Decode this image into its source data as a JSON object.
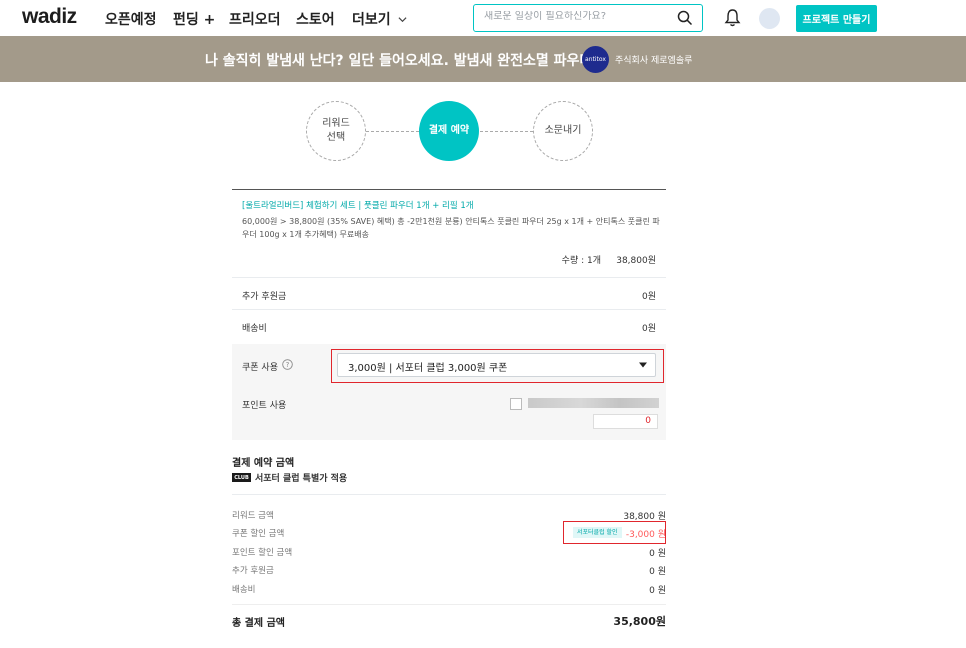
{
  "header": {
    "logo": "wadiz",
    "nav": [
      "오픈예정",
      "펀딩 +",
      "프리오더",
      "스토어",
      "더보기"
    ],
    "search_placeholder": "새로운 일상이 필요하신가요?",
    "make_button": "프로젝트 만들기"
  },
  "banner": {
    "title": "나 솔직히 발냄새 난다? 일단 들어오세요. 발냄새 완전소멸 파우더",
    "maker_logo_text": "antitox",
    "maker_name": "주식회사 제로엠솔루"
  },
  "steps": [
    {
      "label_line1": "리워드",
      "label_line2": "선택"
    },
    {
      "label_line1": "결제 예약",
      "label_line2": ""
    },
    {
      "label_line1": "소문내기",
      "label_line2": ""
    }
  ],
  "order": {
    "reward_title": "[울트라얼리버드] 체험하기 세트 | 풋클린 파우더 1개 + 리필 1개",
    "reward_desc": "60,000원 > 38,800원 (35% SAVE) 혜택) 총 -2만1천원 분룡) 안티톡스 풋클린 파우더 25g x 1개 + 안티톡스 풋클린 파우더 100g x 1개 추가혜택) 무료배송",
    "qty_label": "수량 : 1개",
    "qty_price": "38,800원",
    "extra_support_label": "추가 후원금",
    "extra_support_value": "0원",
    "shipping_label": "배송비",
    "shipping_value": "0원",
    "coupon_label": "쿠폰 사용",
    "coupon_selected": "3,000원 | 서포터 클럽 3,000원 쿠폰",
    "point_label": "포인트 사용",
    "point_value": "0"
  },
  "summary": {
    "title": "결제 예약 금액",
    "club_badge": "CLUB",
    "club_text": "서포터 클럽 특별가 적용",
    "rows": [
      {
        "label": "리워드 금액",
        "value": "38,800 원"
      },
      {
        "label": "쿠폰 할인 금액",
        "value": "-3,000 원",
        "chip": "서포터클럽 할인"
      },
      {
        "label": "포인트 할인 금액",
        "value": "0 원"
      },
      {
        "label": "추가 후원금",
        "value": "0 원"
      },
      {
        "label": "배송비",
        "value": "0 원"
      }
    ],
    "total_label": "총 결제 금액",
    "total_value": "35,800원"
  }
}
